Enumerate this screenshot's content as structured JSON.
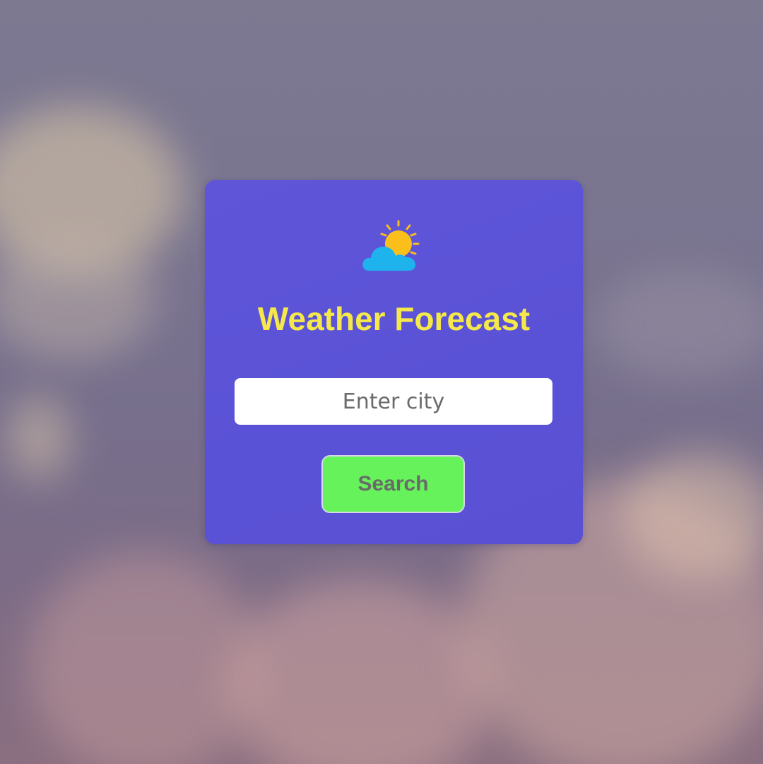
{
  "app": {
    "title": "Weather Forecast",
    "icon": "sun-behind-cloud-icon"
  },
  "search": {
    "placeholder": "Enter city",
    "value": "",
    "button_label": "Search"
  },
  "colors": {
    "card_background": "#5a52d6",
    "title": "#f5e84a",
    "button_background": "#66f25a",
    "button_text": "#6a6a6a",
    "sun": "#fbbf1c",
    "cloud": "#1fb3ee"
  }
}
